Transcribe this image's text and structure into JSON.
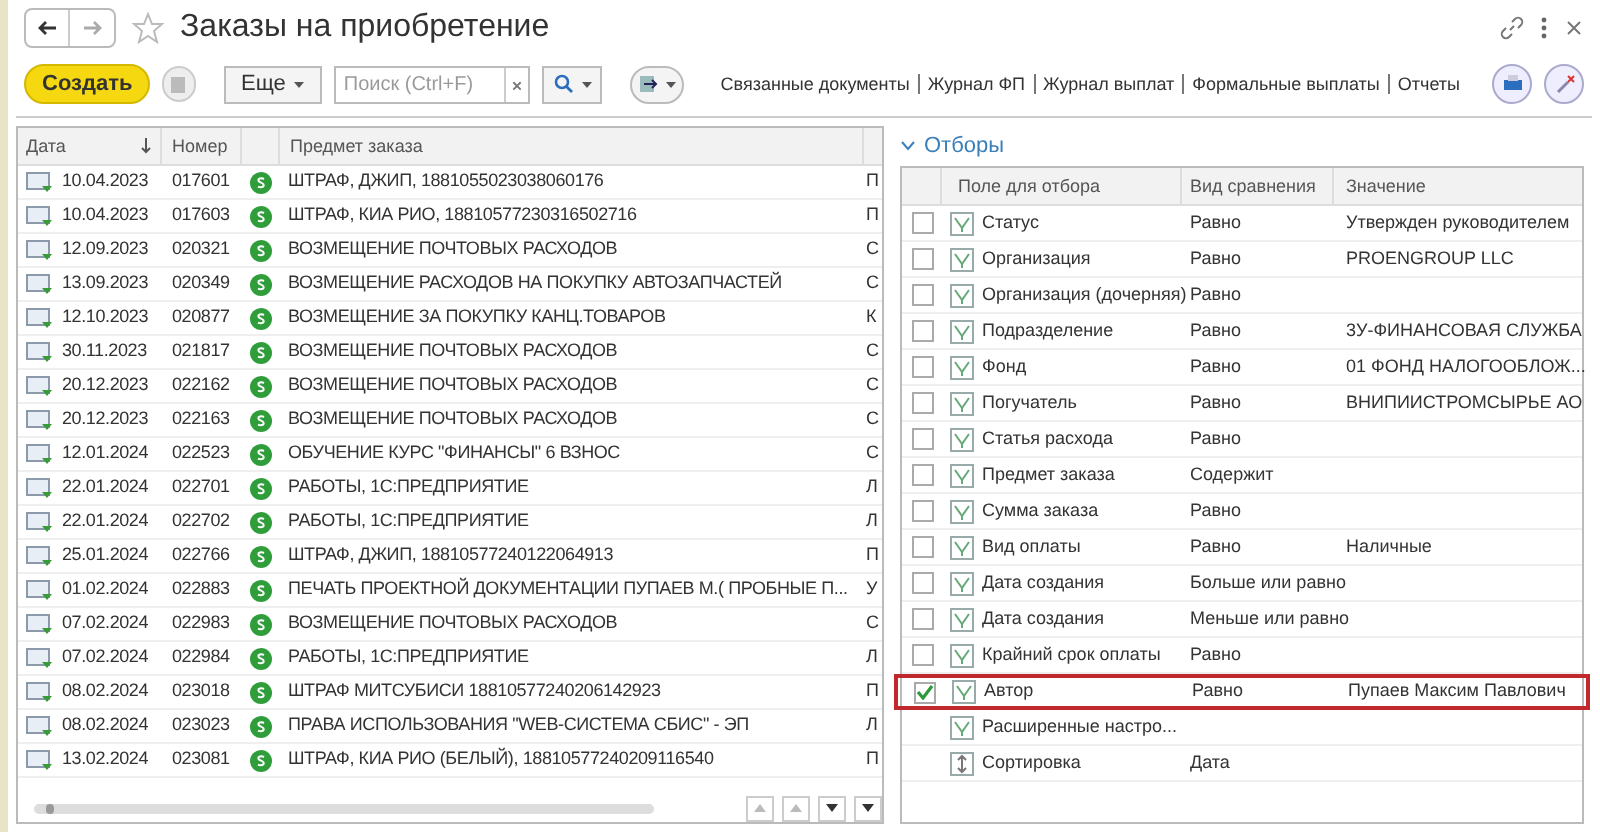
{
  "window": {
    "title": "Заказы на приобретение"
  },
  "toolbar": {
    "create_button": "Создать",
    "more_button": "Еще",
    "search": {
      "placeholder": "Поиск (Ctrl+F)"
    },
    "links": [
      "Связанные документы",
      "Журнал ФП",
      "Журнал выплат",
      "Формальные выплаты",
      "Отчеты"
    ]
  },
  "table": {
    "columns": [
      "Дата",
      "Номер",
      "Предмет заказа"
    ],
    "rows": [
      {
        "date": "10.04.2023",
        "number": "017601",
        "subject": "ШТРАФ, ДЖИП, 1881055023038060176",
        "column_5": "П"
      },
      {
        "date": "10.04.2023",
        "number": "017603",
        "subject": "ШТРАФ, КИА РИО, 18810577230316502716",
        "column_5": "П"
      },
      {
        "date": "12.09.2023",
        "number": "020321",
        "subject": "ВОЗМЕЩЕНИЕ ПОЧТОВЫХ РАСХОДОВ",
        "column_5": "С"
      },
      {
        "date": "13.09.2023",
        "number": "020349",
        "subject": "ВОЗМЕЩЕНИЕ РАСХОДОВ НА ПОКУПКУ АВТОЗАПЧАСТЕЙ",
        "column_5": "С"
      },
      {
        "date": "12.10.2023",
        "number": "020877",
        "subject": "ВОЗМЕЩЕНИЕ ЗА ПОКУПКУ КАНЦ.ТОВАРОВ",
        "column_5": "К"
      },
      {
        "date": "30.11.2023",
        "number": "021817",
        "subject": "ВОЗМЕЩЕНИЕ ПОЧТОВЫХ РАСХОДОВ",
        "column_5": "С"
      },
      {
        "date": "20.12.2023",
        "number": "022162",
        "subject": "ВОЗМЕЩЕНИЕ ПОЧТОВЫХ РАСХОДОВ",
        "column_5": "С"
      },
      {
        "date": "20.12.2023",
        "number": "022163",
        "subject": "ВОЗМЕЩЕНИЕ ПОЧТОВЫХ РАСХОДОВ",
        "column_5": "С"
      },
      {
        "date": "12.01.2024",
        "number": "022523",
        "subject": "ОБУЧЕНИЕ КУРС \"ФИНАНСЫ\" 6 ВЗНОС",
        "column_5": "С"
      },
      {
        "date": "22.01.2024",
        "number": "022701",
        "subject": "РАБОТЫ, 1С:ПРЕДПРИЯТИЕ",
        "column_5": "Л"
      },
      {
        "date": "22.01.2024",
        "number": "022702",
        "subject": "РАБОТЫ, 1С:ПРЕДПРИЯТИЕ",
        "column_5": "Л"
      },
      {
        "date": "25.01.2024",
        "number": "022766",
        "subject": "ШТРАФ, ДЖИП, 18810577240122064913",
        "column_5": "П"
      },
      {
        "date": "01.02.2024",
        "number": "022883",
        "subject": "ПЕЧАТЬ ПРОЕКТНОЙ ДОКУМЕНТАЦИИ ПУПАЕВ М.( ПРОБНЫЕ П...",
        "column_5": "У"
      },
      {
        "date": "07.02.2024",
        "number": "022983",
        "subject": "ВОЗМЕЩЕНИЕ ПОЧТОВЫХ РАСХОДОВ",
        "column_5": "С"
      },
      {
        "date": "07.02.2024",
        "number": "022984",
        "subject": "РАБОТЫ, 1С:ПРЕДПРИЯТИЕ",
        "column_5": "Л"
      },
      {
        "date": "08.02.2024",
        "number": "023018",
        "subject": "ШТРАФ МИТСУБИСИ 18810577240206142923",
        "column_5": "П"
      },
      {
        "date": "08.02.2024",
        "number": "023023",
        "subject": "ПРАВА ИСПОЛЬЗОВАНИЯ \"WEB-СИСТЕМА СБИС\" - ЭП",
        "column_5": "Л"
      },
      {
        "date": "13.02.2024",
        "number": "023081",
        "subject": "ШТРАФ, КИА РИО (БЕЛЫЙ), 18810577240209116540",
        "column_5": "П"
      }
    ]
  },
  "filters": {
    "title": "Отборы",
    "expanded": true,
    "columns": [
      "Поле для отбора",
      "Вид сравнения",
      "Значение"
    ],
    "rows": [
      {
        "kind": "filter",
        "checked": false,
        "highlighted": false,
        "field": "Статус",
        "comparison": "Равно",
        "value": "Утвержден руководителем"
      },
      {
        "kind": "filter",
        "checked": false,
        "highlighted": false,
        "field": "Организация",
        "comparison": "Равно",
        "value": "PROENGROUP LLC"
      },
      {
        "kind": "filter",
        "checked": false,
        "highlighted": false,
        "field": "Организация (дочерняя)",
        "comparison": "Равно"
      },
      {
        "kind": "filter",
        "checked": false,
        "highlighted": false,
        "field": "Подразделение",
        "comparison": "Равно",
        "value": "3У-ФИНАНСОВАЯ СЛУЖБА"
      },
      {
        "kind": "filter",
        "checked": false,
        "highlighted": false,
        "field": "Фонд",
        "comparison": "Равно",
        "value": "01 ФОНД НАЛОГООБЛОЖ..."
      },
      {
        "kind": "filter",
        "checked": false,
        "highlighted": false,
        "field": "Погучатель",
        "comparison": "Равно",
        "value": "ВНИПИИСТРОМСЫРЬЕ АО"
      },
      {
        "kind": "filter",
        "checked": false,
        "highlighted": false,
        "field": "Статья расхода",
        "comparison": "Равно"
      },
      {
        "kind": "filter",
        "checked": false,
        "highlighted": false,
        "field": "Предмет заказа",
        "comparison": "Содержит"
      },
      {
        "kind": "filter",
        "checked": false,
        "highlighted": false,
        "field": "Сумма заказа",
        "comparison": "Равно"
      },
      {
        "kind": "filter",
        "checked": false,
        "highlighted": false,
        "field": "Вид оплаты",
        "comparison": "Равно",
        "value": "Наличные"
      },
      {
        "kind": "filter",
        "checked": false,
        "highlighted": false,
        "field": "Дата создания",
        "comparison": "Больше или равно"
      },
      {
        "kind": "filter",
        "checked": false,
        "highlighted": false,
        "field": "Дата создания",
        "comparison": "Меньше или равно"
      },
      {
        "kind": "filter",
        "checked": false,
        "highlighted": false,
        "field": "Крайний срок оплаты",
        "comparison": "Равно"
      },
      {
        "kind": "filter",
        "checked": true,
        "highlighted": true,
        "field": "Автор",
        "comparison": "Равно",
        "value": "Пупаев Максим Павлович"
      },
      {
        "kind": "settings",
        "field": "Расширенные настро..."
      },
      {
        "kind": "sort",
        "field": "Сортировка",
        "comparison": "Дата"
      }
    ]
  }
}
